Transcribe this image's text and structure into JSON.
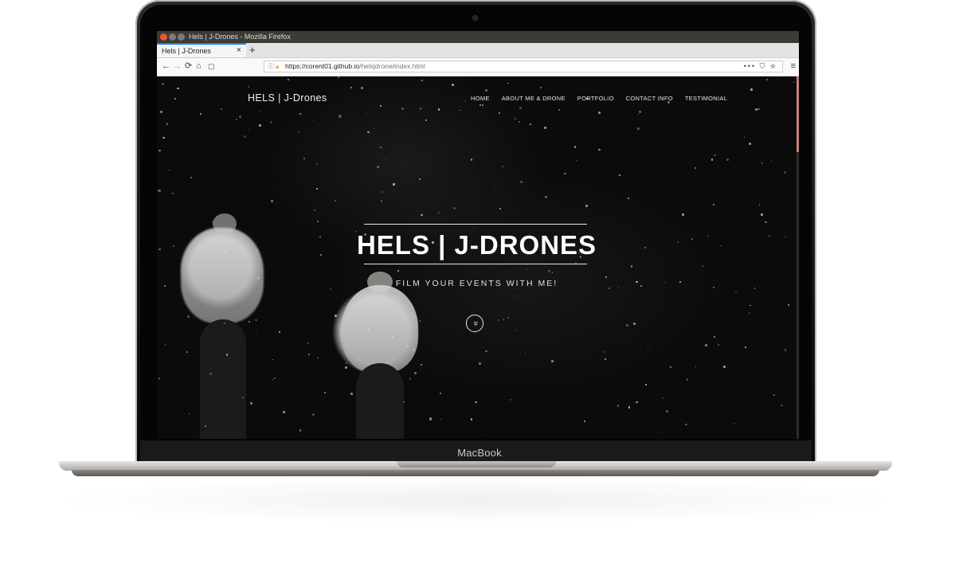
{
  "window": {
    "title": "Hels | J-Drones - Mozilla Firefox"
  },
  "tab": {
    "label": "Hels | J-Drones",
    "close": "×",
    "new_tab": "+"
  },
  "nav_icons": {
    "back": "←",
    "forward": "→",
    "reload": "⟳",
    "home": "⌂",
    "reader": "▢",
    "menu": "≡"
  },
  "urlbar": {
    "domain": "https://corent01.github.io",
    "path": "/helsjdrone/index.html",
    "actions": "••• ⛉ ☆"
  },
  "site": {
    "logo": "HELS | J-Drones",
    "nav": [
      "HOME",
      "ABOUT ME & DRONE",
      "PORTFOLIO",
      "CONTACT INFO",
      "TESTIMONIAL"
    ],
    "hero_title": "HELS | J-DRONES",
    "hero_subtitle": "FILM YOUR EVENTS WITH ME!",
    "scroll_icon": "»"
  },
  "device": {
    "brand": "MacBook"
  },
  "colors": {
    "accent_tab": "#0a84ff",
    "scroll_thumb": "#c9827a",
    "title_bar": "#3c3b37"
  }
}
